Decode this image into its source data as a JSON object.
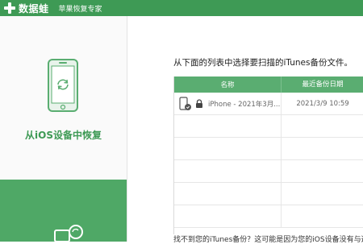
{
  "titlebar": {
    "brand_name": "数据蛙",
    "product_name": "苹果恢复专家"
  },
  "sidebar": {
    "ios_restore_label": "从iOS设备中恢复"
  },
  "main": {
    "instruction": "从下面的列表中选择要扫描的iTunes备份文件。",
    "table": {
      "headers": {
        "name": "名称",
        "date": "最近备份日期"
      },
      "rows": [
        {
          "name": "iPhone - 2021年3月...",
          "date": "2021/3/9 10:59"
        }
      ]
    },
    "footer_note": "找不到您的iTunes备份？这可能是因为您的iOS设备没有与这台电脑"
  },
  "colors": {
    "brand_green": "#3e9a55",
    "header_green": "#5aad71"
  }
}
